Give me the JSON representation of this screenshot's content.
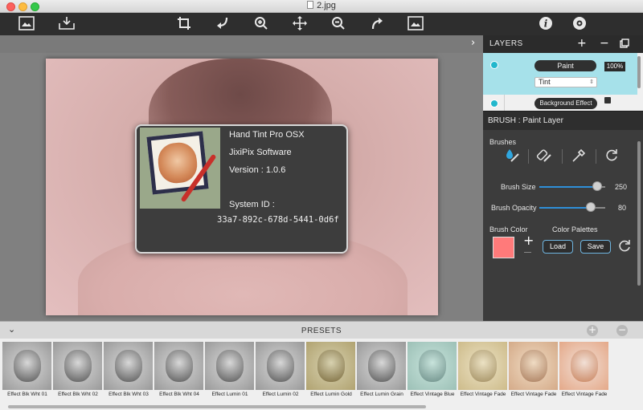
{
  "window": {
    "title": "2.jpg"
  },
  "toolbar": {
    "icons": [
      "open-image-icon",
      "save-image-icon",
      "crop-icon",
      "undo-icon",
      "zoom-in-icon",
      "move-icon",
      "zoom-out-icon",
      "redo-icon",
      "fit-image-icon",
      "info-icon",
      "settings-icon"
    ]
  },
  "about": {
    "app_name": "Hand Tint Pro OSX",
    "company": "JixiPix Software",
    "version": "Version : 1.0.6",
    "system_id_label": "System ID :",
    "system_id": "33a7-892c-678d-5441-0d6f"
  },
  "layers": {
    "title": "LAYERS",
    "items": [
      {
        "name": "Paint",
        "opacity": "100%",
        "blend": "Tint"
      },
      {
        "name": "Background Effect"
      }
    ]
  },
  "brush": {
    "title": "BRUSH : Paint Layer",
    "brushes_label": "Brushes",
    "size_label": "Brush Size",
    "size_value": "250",
    "size_fraction": 0.88,
    "opacity_label": "Brush Opacity",
    "opacity_value": "80",
    "opacity_fraction": 0.78,
    "color_label": "Brush Color",
    "color": "#ff7a7a",
    "palettes_label": "Color Palettes",
    "load_label": "Load",
    "save_label": "Save"
  },
  "presets": {
    "title": "PRESETS",
    "items": [
      {
        "label": "Effect Blk Wht 01",
        "tone": "bw"
      },
      {
        "label": "Effect Blk Wht 02",
        "tone": "bw"
      },
      {
        "label": "Effect Blk Wht 03",
        "tone": "bw"
      },
      {
        "label": "Effect Blk Wht 04",
        "tone": "bw"
      },
      {
        "label": "Effect Lumin 01",
        "tone": "bw"
      },
      {
        "label": "Effect Lumin 02",
        "tone": "bw"
      },
      {
        "label": "Effect Lumin Gold",
        "tone": "gold"
      },
      {
        "label": "Effect Lumin Grain",
        "tone": "bw"
      },
      {
        "label": "Effect Vintage Blue",
        "tone": "blue"
      },
      {
        "label": "Effect Vintage Fade",
        "tone": "fade"
      },
      {
        "label": "Effect Vintage Fade",
        "tone": "warm"
      },
      {
        "label": "Effect Vintage Fade",
        "tone": "color"
      }
    ]
  }
}
